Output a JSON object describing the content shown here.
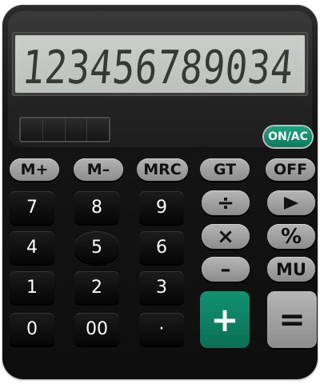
{
  "display": {
    "readout": "123456789034"
  },
  "memory_keys": [
    "M+",
    "M–",
    "MRC",
    "GT",
    "OFF"
  ],
  "onac_label": "ON/AC",
  "ops": {
    "divide": "÷",
    "multiply": "×",
    "percent": "%",
    "minus": "–",
    "mu": "MU",
    "plus": "+",
    "equals": "="
  },
  "digits": [
    "7",
    "8",
    "9",
    "4",
    "5",
    "6",
    "1",
    "2",
    "3",
    "0",
    "00",
    "·"
  ]
}
